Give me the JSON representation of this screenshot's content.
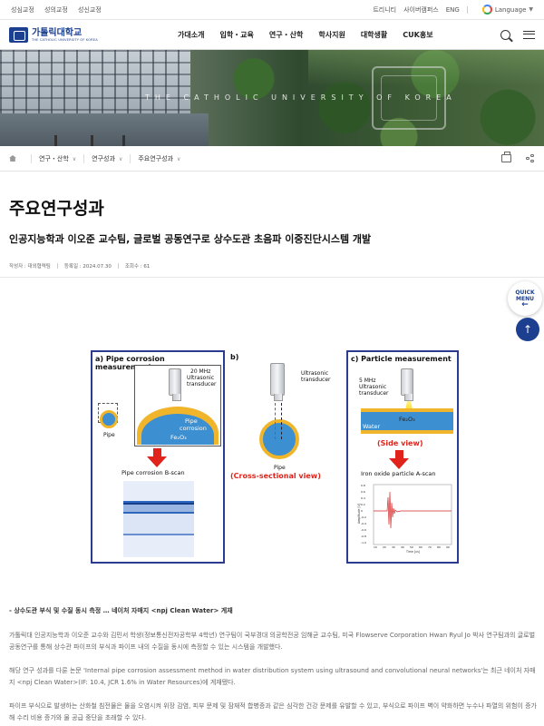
{
  "util": {
    "left_links": [
      "성심교정",
      "성의교정",
      "성신교정"
    ],
    "right_links": [
      "트리니티",
      "사이버캠퍼스",
      "ENG"
    ],
    "language_label": "Language"
  },
  "header": {
    "logo_ko": "가톨릭대학교",
    "logo_en": "THE CATHOLIC UNIVERSITY OF KOREA",
    "nav": [
      "가대소개",
      "입학・교육",
      "연구・산학",
      "학사지원",
      "대학생활",
      "CUK홍보"
    ]
  },
  "banner": {
    "text": "THE CATHOLIC UNIVERSITY OF KOREA"
  },
  "breadcrumb": {
    "items": [
      "연구・산학",
      "연구성과",
      "주요연구성과"
    ]
  },
  "page": {
    "title": "주요연구성과",
    "article_title": "인공지능학과 이오준 교수팀, 글로벌 공동연구로 상수도관 초음파 이중진단시스템 개발",
    "meta": {
      "author": "작성자 : 대외협력팀",
      "date": "등록일 : 2024.07.30",
      "views": "조회수 : 61"
    }
  },
  "figure": {
    "panel_a_title": "a) Pipe corrosion measurement",
    "panel_a_freq": "20 MHz",
    "panel_a_ultra": "Ultrasonic",
    "panel_a_trans": "transducer",
    "panel_a_pipe_corrosion_1": "Pipe",
    "panel_a_pipe_corrosion_2": "corrosion",
    "panel_a_fe": "Fe₂O₃",
    "panel_a_pipe": "Pipe",
    "panel_a_bscan": "Pipe corrosion B-scan",
    "panel_b_title": "b)",
    "panel_b_ultra": "Ultrasonic",
    "panel_b_trans": "transducer",
    "panel_b_pipe": "Pipe",
    "panel_b_cross": "(Cross-sectional view)",
    "panel_c_title": "c) Particle measurement",
    "panel_c_freq": "5 MHz",
    "panel_c_ultra": "Ultrasonic",
    "panel_c_trans": "transducer",
    "panel_c_water": "Water",
    "panel_c_fe": "Fe₂O₃",
    "panel_c_side": "(Side view)",
    "panel_c_ascan": "Iron oxide particle A-scan",
    "panel_c_xlabel": "Time [us]",
    "panel_c_ylabel": "Amplitude [V]",
    "panel_c_yticks": [
      "0.8",
      "0.6",
      "0.4",
      "0.2",
      "0",
      "-0.2",
      "-0.4",
      "-0.6",
      "-0.8",
      "-1.0"
    ],
    "panel_c_xticks": [
      "10",
      "20",
      "30",
      "40",
      "50",
      "60",
      "70",
      "80",
      "90"
    ]
  },
  "side": {
    "quick_1": "QUICK",
    "quick_2": "MENU",
    "quick_arrow": "←",
    "top_arrow": "↑"
  },
  "body": {
    "summary": "- 상수도관 부식 및 수질 동시 측정 … 네이처 자매지 <npj Clean Water> 게재",
    "p1": "가톨릭대 인공지능학과 이오준 교수와 김민서 학생(정보통신전자공학부 4학년) 연구팀이 국부경대 의공학전공 임해균 교수팀, 미국 Flowserve Corporation Hwan Ryul Jo 박사 연구팀과의 글로벌 공동연구를 통해 상수관 파이프의 부식과 파이프 내의 수질을 동시에 측정할 수 있는 시스템을 개발했다.",
    "p2": "해당 연구 성과를 다룬 논문 'Internal pipe corrosion assessment method in water distribution system using ultrasound and convolutional neural networks'는 최근 네이처 자매지 <npj Clean Water>(IF: 10.4, JCR 1.6% in Water Resources)에 게재됐다.",
    "p3": "파이프 부식으로 발생하는 산화철 침전물은 물을 오염시켜 위장 감염, 피부 문제 및 잠재적 합병증과 같은 심각한 건강 문제를 유발할 수 있고, 부식으로 파이프 벽이 약화하면 누수나 파열의 위험이 증가해 수리 비용 증가와 물 공급 중단을 초래할 수 있다."
  },
  "colors": {
    "brand": "#1c3f8f",
    "accent_red": "#e0241b",
    "panel_border": "#2b3b8f"
  }
}
